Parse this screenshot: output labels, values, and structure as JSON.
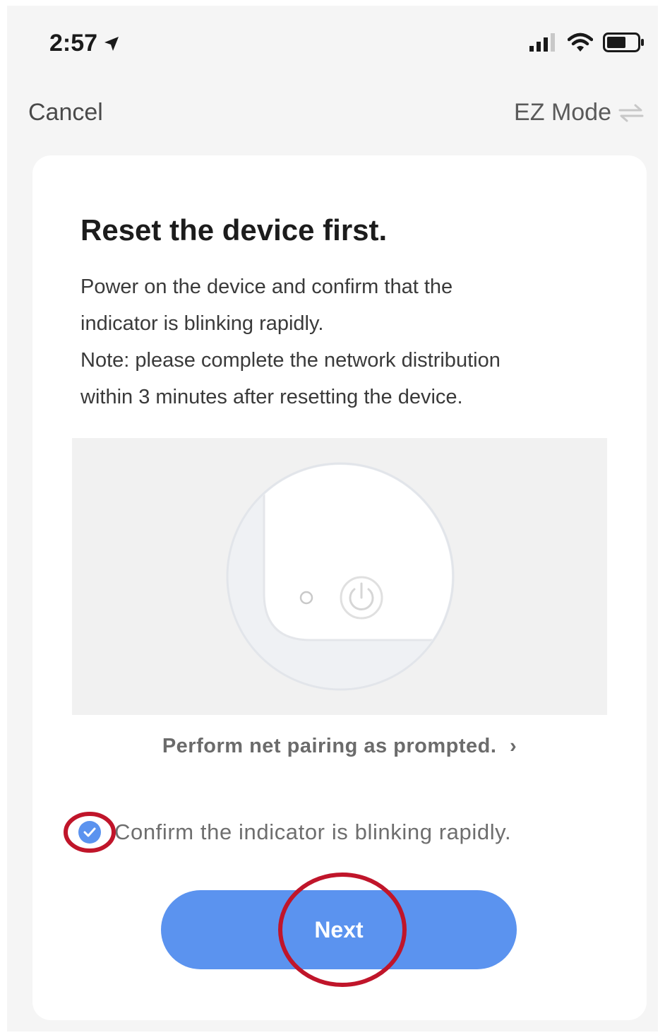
{
  "status_bar": {
    "time": "2:57",
    "icons": [
      "location-arrow-icon",
      "cellular-signal-icon",
      "wifi-icon",
      "battery-icon"
    ]
  },
  "nav": {
    "cancel_label": "Cancel",
    "mode_label": "EZ Mode",
    "mode_icon": "switch-arrows-icon"
  },
  "card": {
    "title": "Reset the device first.",
    "description_lines": [
      "Power on the device and confirm that the",
      "indicator is blinking rapidly.",
      "Note: please complete the network distribution",
      "within 3 minutes after resetting the device."
    ],
    "illustration_icons": [
      "indicator-light-icon",
      "power-button-icon"
    ],
    "pairing_link": "Perform net pairing as prompted.",
    "pairing_link_chevron": "›",
    "confirm_checked": true,
    "confirm_label": "Confirm the indicator is blinking rapidly.",
    "next_label": "Next"
  },
  "colors": {
    "accent": "#5b93ef",
    "annotation": "#c0152a",
    "screen_bg": "#f5f5f5",
    "card_bg": "#ffffff"
  }
}
